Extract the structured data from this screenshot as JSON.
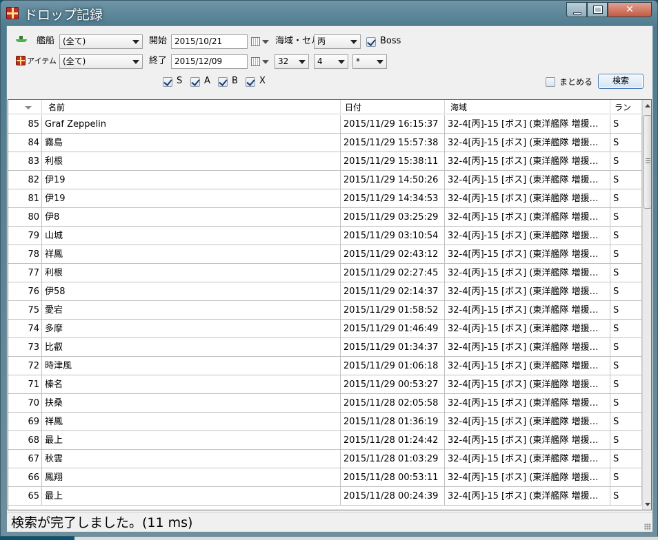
{
  "window": {
    "title": "ドロップ記録",
    "colors": {
      "accent": "#4a7cb8",
      "close": "#c45a42",
      "ship_icon": "#4caf50",
      "item_icon": "#c62828"
    }
  },
  "filters": {
    "ship_label": "艦船",
    "ship_value": "(全て)",
    "item_label": "アイテム",
    "item_value": "(全て)",
    "start_label": "開始",
    "start_value": "2015/10/21",
    "end_label": "終了",
    "end_value": "2015/12/09",
    "area_label": "海域・セル",
    "area_value": "丙",
    "boss_label": "Boss",
    "boss_checked": true,
    "map_value": "32",
    "area_no_value": "4",
    "cell_value": "*",
    "rank_s": "S",
    "rank_a": "A",
    "rank_b": "B",
    "rank_x": "X",
    "combine_label": "まとめる",
    "search_label": "検索"
  },
  "table": {
    "columns": {
      "num": "",
      "name": "名前",
      "date": "日付",
      "area": "海域",
      "rank": "ラン"
    },
    "rows": [
      {
        "num": "85",
        "name": "Graf Zeppelin",
        "date": "2015/11/29 16:15:37",
        "area": "32-4[丙]-15 [ボス] (東洋艦隊 増援…",
        "rank": "S"
      },
      {
        "num": "84",
        "name": "霧島",
        "date": "2015/11/29 15:57:38",
        "area": "32-4[丙]-15 [ボス] (東洋艦隊 増援…",
        "rank": "S"
      },
      {
        "num": "83",
        "name": "利根",
        "date": "2015/11/29 15:38:11",
        "area": "32-4[丙]-15 [ボス] (東洋艦隊 増援…",
        "rank": "S"
      },
      {
        "num": "82",
        "name": "伊19",
        "date": "2015/11/29 14:50:26",
        "area": "32-4[丙]-15 [ボス] (東洋艦隊 増援…",
        "rank": "S"
      },
      {
        "num": "81",
        "name": "伊19",
        "date": "2015/11/29 14:34:53",
        "area": "32-4[丙]-15 [ボス] (東洋艦隊 増援…",
        "rank": "S"
      },
      {
        "num": "80",
        "name": "伊8",
        "date": "2015/11/29 03:25:29",
        "area": "32-4[丙]-15 [ボス] (東洋艦隊 増援…",
        "rank": "S"
      },
      {
        "num": "79",
        "name": "山城",
        "date": "2015/11/29 03:10:54",
        "area": "32-4[丙]-15 [ボス] (東洋艦隊 増援…",
        "rank": "S"
      },
      {
        "num": "78",
        "name": "祥鳳",
        "date": "2015/11/29 02:43:12",
        "area": "32-4[丙]-15 [ボス] (東洋艦隊 増援…",
        "rank": "S"
      },
      {
        "num": "77",
        "name": "利根",
        "date": "2015/11/29 02:27:45",
        "area": "32-4[丙]-15 [ボス] (東洋艦隊 増援…",
        "rank": "S"
      },
      {
        "num": "76",
        "name": "伊58",
        "date": "2015/11/29 02:14:37",
        "area": "32-4[丙]-15 [ボス] (東洋艦隊 増援…",
        "rank": "S"
      },
      {
        "num": "75",
        "name": "愛宕",
        "date": "2015/11/29 01:58:52",
        "area": "32-4[丙]-15 [ボス] (東洋艦隊 増援…",
        "rank": "S"
      },
      {
        "num": "74",
        "name": "多摩",
        "date": "2015/11/29 01:46:49",
        "area": "32-4[丙]-15 [ボス] (東洋艦隊 増援…",
        "rank": "S"
      },
      {
        "num": "73",
        "name": "比叡",
        "date": "2015/11/29 01:34:37",
        "area": "32-4[丙]-15 [ボス] (東洋艦隊 増援…",
        "rank": "S"
      },
      {
        "num": "72",
        "name": "時津風",
        "date": "2015/11/29 01:06:18",
        "area": "32-4[丙]-15 [ボス] (東洋艦隊 増援…",
        "rank": "S"
      },
      {
        "num": "71",
        "name": "榛名",
        "date": "2015/11/29 00:53:27",
        "area": "32-4[丙]-15 [ボス] (東洋艦隊 増援…",
        "rank": "S"
      },
      {
        "num": "70",
        "name": "扶桑",
        "date": "2015/11/28 02:05:58",
        "area": "32-4[丙]-15 [ボス] (東洋艦隊 増援…",
        "rank": "S"
      },
      {
        "num": "69",
        "name": "祥鳳",
        "date": "2015/11/28 01:36:19",
        "area": "32-4[丙]-15 [ボス] (東洋艦隊 増援…",
        "rank": "S"
      },
      {
        "num": "68",
        "name": "最上",
        "date": "2015/11/28 01:24:42",
        "area": "32-4[丙]-15 [ボス] (東洋艦隊 増援…",
        "rank": "S"
      },
      {
        "num": "67",
        "name": "秋雲",
        "date": "2015/11/28 01:03:29",
        "area": "32-4[丙]-15 [ボス] (東洋艦隊 増援…",
        "rank": "S"
      },
      {
        "num": "66",
        "name": "鳳翔",
        "date": "2015/11/28 00:53:11",
        "area": "32-4[丙]-15 [ボス] (東洋艦隊 増援…",
        "rank": "S"
      },
      {
        "num": "65",
        "name": "最上",
        "date": "2015/11/28 00:24:39",
        "area": "32-4[丙]-15 [ボス] (東洋艦隊 増援…",
        "rank": "S"
      }
    ]
  },
  "status": {
    "text": "検索が完了しました。(11 ms)"
  }
}
